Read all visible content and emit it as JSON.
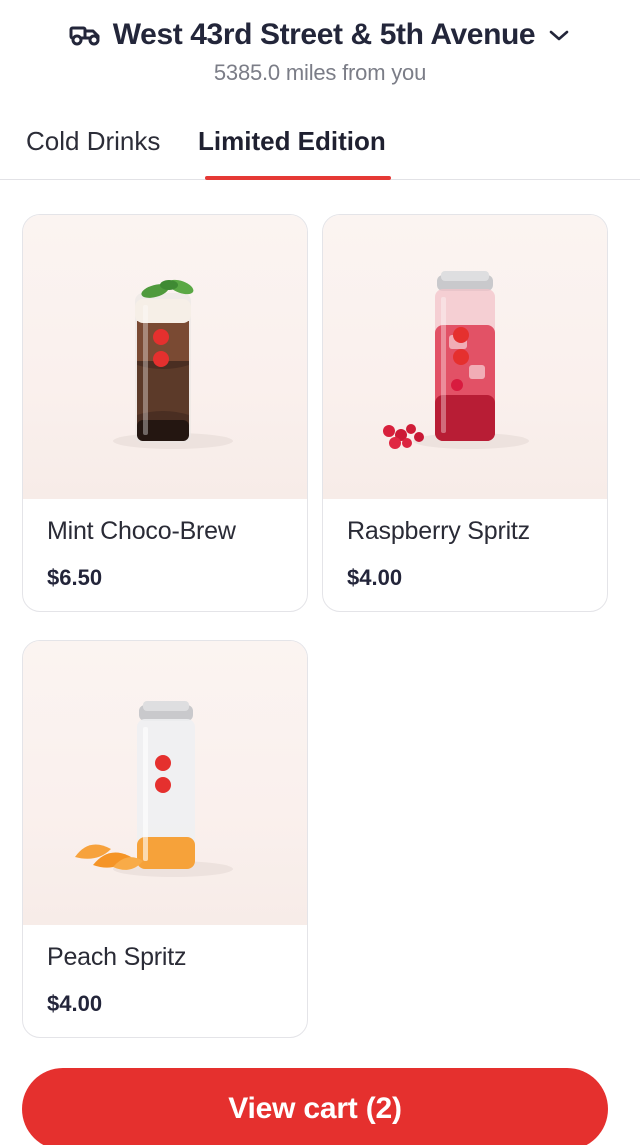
{
  "header": {
    "location": "West 43rd Street & 5th Avenue",
    "distance": "5385.0 miles from you",
    "truck_icon": "delivery-truck-icon",
    "chevron_icon": "chevron-down-icon"
  },
  "tabs": [
    {
      "label": "Cold Drinks",
      "active": false
    },
    {
      "label": "Limited Edition",
      "active": true
    }
  ],
  "products": [
    {
      "name": "Mint Choco-Brew",
      "price": "$6.50",
      "image": "mint-choco-brew-drink"
    },
    {
      "name": "Raspberry Spritz",
      "price": "$4.00",
      "image": "raspberry-spritz-drink"
    },
    {
      "name": "Peach Spritz",
      "price": "$4.00",
      "image": "peach-spritz-drink"
    }
  ],
  "cart_button": {
    "label": "View cart (2)"
  },
  "colors": {
    "accent": "#e5302e",
    "tab_underline": "#e53935",
    "text_primary": "#23263a",
    "text_secondary": "#7b7d87"
  }
}
